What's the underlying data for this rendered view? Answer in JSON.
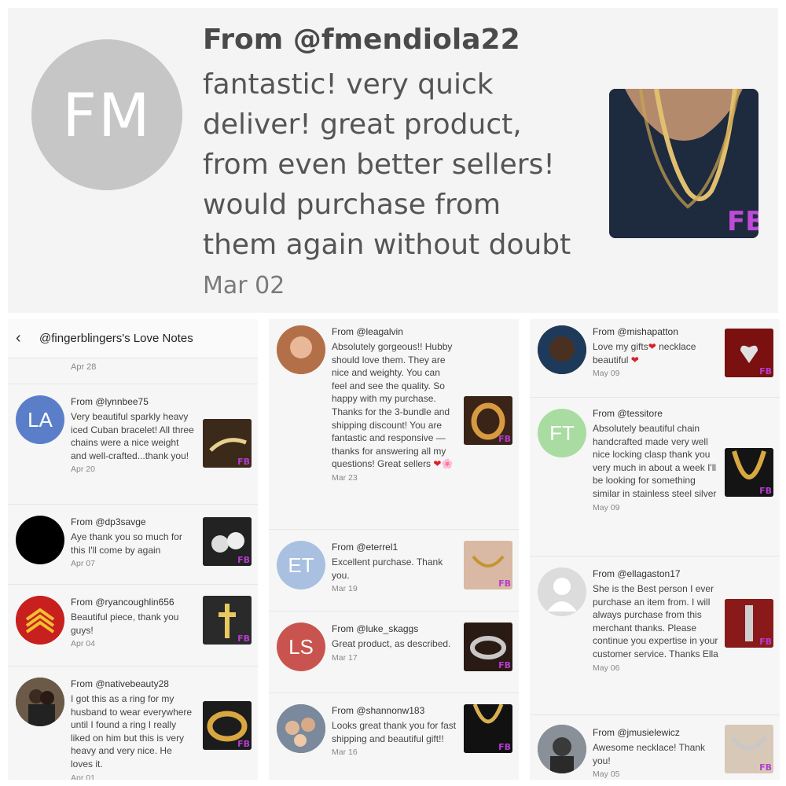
{
  "hero": {
    "initials": "FM",
    "from": "From @fmendiola22",
    "text_lines": [
      "fantastic! very quick",
      "deliver! great product,",
      "from even better sellers!",
      "would purchase from",
      "them again without doubt"
    ],
    "date": "Mar 02",
    "badge": "FB"
  },
  "col1": {
    "back_icon": "‹",
    "title": "@fingerblingers's Love Notes",
    "first_date": "Apr 28",
    "reviews": [
      {
        "initials": "LA",
        "from": "From @lynnbee75",
        "text": "Very beautiful sparkly heavy iced Cuban bracelet! All three chains were a nice weight and well-crafted...thank you!",
        "date": "Apr 20"
      },
      {
        "initials": "",
        "from": "From @dp3savge",
        "text": "Aye thank you so much for this I'll come by again",
        "date": "Apr 07"
      },
      {
        "initials": "",
        "from": "From @ryancoughlin656",
        "text": "Beautiful piece, thank you guys!",
        "date": "Apr 04"
      },
      {
        "initials": "",
        "from": "From @nativebeauty28",
        "text": "I got this as a ring for my husband to wear everywhere until I found a ring I really liked on him but this is very heavy and very nice. He loves it.",
        "date": "Apr 01"
      }
    ]
  },
  "col2": {
    "reviews": [
      {
        "initials": "",
        "from": "From @leagalvin",
        "text": "Absolutely gorgeous!! Hubby should love them. They are nice and weighty. You can feel and see the quality. So happy with my purchase. Thanks for the 3-bundle and shipping discount! You are fantastic and responsive — thanks for answering all my questions! Great sellers",
        "emoji": "❤🌸",
        "date": "Mar 23"
      },
      {
        "initials": "ET",
        "from": "From @eterrel1",
        "text": "Excellent purchase. Thank you.",
        "date": "Mar 19"
      },
      {
        "initials": "LS",
        "from": "From @luke_skaggs",
        "text": "Great product, as described.",
        "date": "Mar 17"
      },
      {
        "initials": "",
        "from": "From @shannonw183",
        "text": "Looks great thank you for fast shipping and beautiful gift!!",
        "date": "Mar 16"
      }
    ]
  },
  "col3": {
    "reviews": [
      {
        "initials": "",
        "from": "From @mishapatton",
        "text_a": "Love my gifts",
        "text_b": " necklace beautiful ",
        "date": "May 09"
      },
      {
        "initials": "FT",
        "from": "From @tessitore",
        "text": "Absolutely beautiful chain handcrafted made very well nice locking clasp thank you very much in about a week I'll be looking for something similar in stainless steel silver",
        "date": "May 09"
      },
      {
        "initials": "",
        "from": "From @ellagaston17",
        "text": "She is the Best person I ever purchase an item from. I will always purchase from this merchant thanks. Please continue you expertise in your customer service. Thanks Ella",
        "date": "May 06"
      },
      {
        "initials": "",
        "from": "From @jmusielewicz",
        "text": "Awesome necklace! Thank you!",
        "date": "May 05"
      }
    ]
  },
  "colors": {
    "la": "#5b7ec9",
    "et": "#a9c0e0",
    "ls": "#c9544f",
    "ft": "#a8dca0",
    "heart": "#d8202a",
    "badge": "#b53ccf"
  }
}
